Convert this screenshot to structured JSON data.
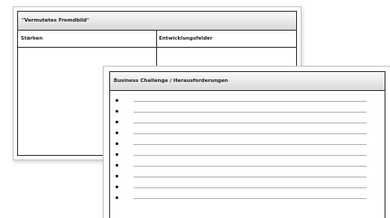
{
  "back_card": {
    "title": "\"Vermutetes Fremdbild\"",
    "col_left": "Stärken",
    "col_right": "Entwicklungsfelder"
  },
  "front_card": {
    "title": "Business Challenge / Herausforderungen",
    "bullets": [
      "",
      "",
      "",
      "",
      "",
      "",
      "",
      "",
      "",
      ""
    ]
  }
}
